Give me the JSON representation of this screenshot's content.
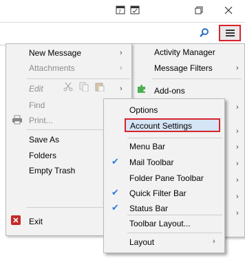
{
  "main_menu": {
    "items": [
      {
        "label": "New Message",
        "has_submenu": true,
        "disabled": false
      },
      {
        "label": "Attachments",
        "has_submenu": true,
        "disabled": true
      },
      {
        "label": "Edit",
        "has_submenu": true,
        "disabled": true
      },
      {
        "label": "Find",
        "has_submenu": false,
        "disabled": true
      },
      {
        "label": "Print...",
        "has_submenu": false,
        "disabled": true
      },
      {
        "label": "Save As",
        "has_submenu": false,
        "disabled": false
      },
      {
        "label": "Folders",
        "has_submenu": false,
        "disabled": false
      },
      {
        "label": "Empty Trash",
        "has_submenu": false,
        "disabled": false
      },
      {
        "label": "Exit",
        "has_submenu": false,
        "disabled": false
      }
    ]
  },
  "app_menu": {
    "items": [
      {
        "label": "Activity Manager"
      },
      {
        "label": "Message Filters",
        "has_submenu": true
      },
      {
        "label": "Add-ons"
      }
    ]
  },
  "options_submenu": {
    "items": [
      {
        "label": "Options"
      },
      {
        "label": "Account Settings",
        "highlighted": true
      },
      {
        "label": "Menu Bar",
        "checked": false
      },
      {
        "label": "Mail Toolbar",
        "checked": true
      },
      {
        "label": "Folder Pane Toolbar",
        "checked": false
      },
      {
        "label": "Quick Filter Bar",
        "checked": true
      },
      {
        "label": "Status Bar",
        "checked": true
      },
      {
        "label": "Toolbar Layout..."
      },
      {
        "label": "Layout",
        "has_submenu": true
      }
    ]
  },
  "colors": {
    "highlight_border": "#d9222a",
    "check": "#2a7ad8"
  }
}
